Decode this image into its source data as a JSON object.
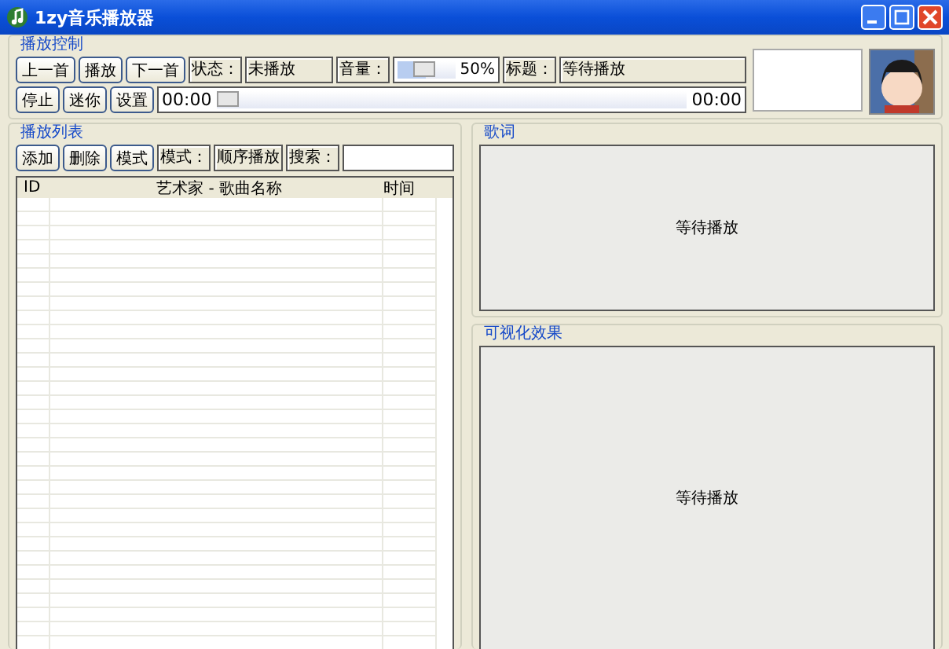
{
  "window": {
    "title": "1zy音乐播放器"
  },
  "playback_control": {
    "title": "播放控制",
    "buttons_top": [
      "上一首",
      "播放",
      "下一首"
    ],
    "buttons_bottom": [
      "停止",
      "迷你",
      "设置"
    ],
    "status_label": "状态：",
    "status": "未播放",
    "volume_label": "音量：",
    "volume": {
      "level": 0.5,
      "reading": "50%"
    },
    "title_label": "标题：",
    "title_value": "等待播放",
    "progress": {
      "level": 0,
      "elapsed": "00:00",
      "total": "00:00"
    }
  },
  "playlist": {
    "title": "播放列表",
    "buttons": [
      "添加",
      "删除",
      "模式"
    ],
    "mode_label": "模式：",
    "mode": "顺序播放",
    "search_label": "搜索：",
    "columns": [
      "ID",
      "艺术家 - 歌曲名称",
      "时间"
    ]
  },
  "lyrics": {
    "title": "歌词",
    "text": "等待播放"
  },
  "visualization": {
    "title": "可视化效果",
    "text": "等待播放"
  }
}
